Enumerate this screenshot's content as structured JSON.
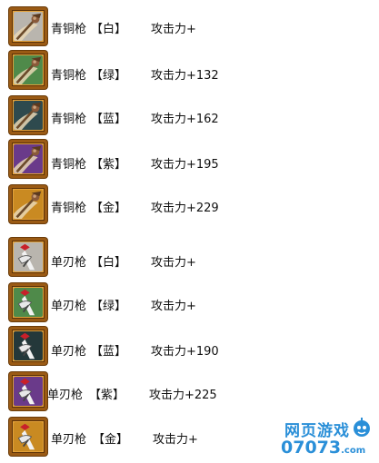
{
  "items": [
    {
      "name": "青铜枪",
      "grade": "【白】",
      "stat": "攻击力+",
      "bg": "#b9b5ae",
      "kind": "spear"
    },
    {
      "name": "青铜枪",
      "grade": "【绿】",
      "stat": "攻击力+132",
      "bg": "#4f8a4a",
      "kind": "spear"
    },
    {
      "name": "青铜枪",
      "grade": "【蓝】",
      "stat": "攻击力+162",
      "bg": "#2e4a4e",
      "kind": "spear"
    },
    {
      "name": "青铜枪",
      "grade": "【紫】",
      "stat": "攻击力+195",
      "bg": "#6a3a8a",
      "kind": "spear"
    },
    {
      "name": "青铜枪",
      "grade": "【金】",
      "stat": "攻击力+229",
      "bg": "#c98a22",
      "kind": "spear"
    },
    {
      "name": "单刃枪",
      "grade": "【白】",
      "stat": "攻击力+",
      "bg": "#b9b5ae",
      "kind": "blade"
    },
    {
      "name": "单刃枪",
      "grade": "【绿】",
      "stat": "攻击力+",
      "bg": "#4f8a4a",
      "kind": "blade"
    },
    {
      "name": "单刃枪",
      "grade": "【蓝】",
      "stat": "攻击力+190",
      "bg": "#24383a",
      "kind": "blade"
    },
    {
      "name": "单刃枪",
      "grade": "【紫】",
      "stat": "攻击力+225",
      "bg": "#6a3a8a",
      "kind": "blade"
    },
    {
      "name": "单刃枪",
      "grade": "【金】",
      "stat": "攻击力+",
      "bg": "#c98a22",
      "kind": "blade"
    }
  ],
  "watermark": {
    "site_cn": "网页游戏",
    "site_num": "07073",
    "site_tld": ".com"
  },
  "colors": {
    "frame": "#9a5a14",
    "accent": "#2a8fd8"
  }
}
